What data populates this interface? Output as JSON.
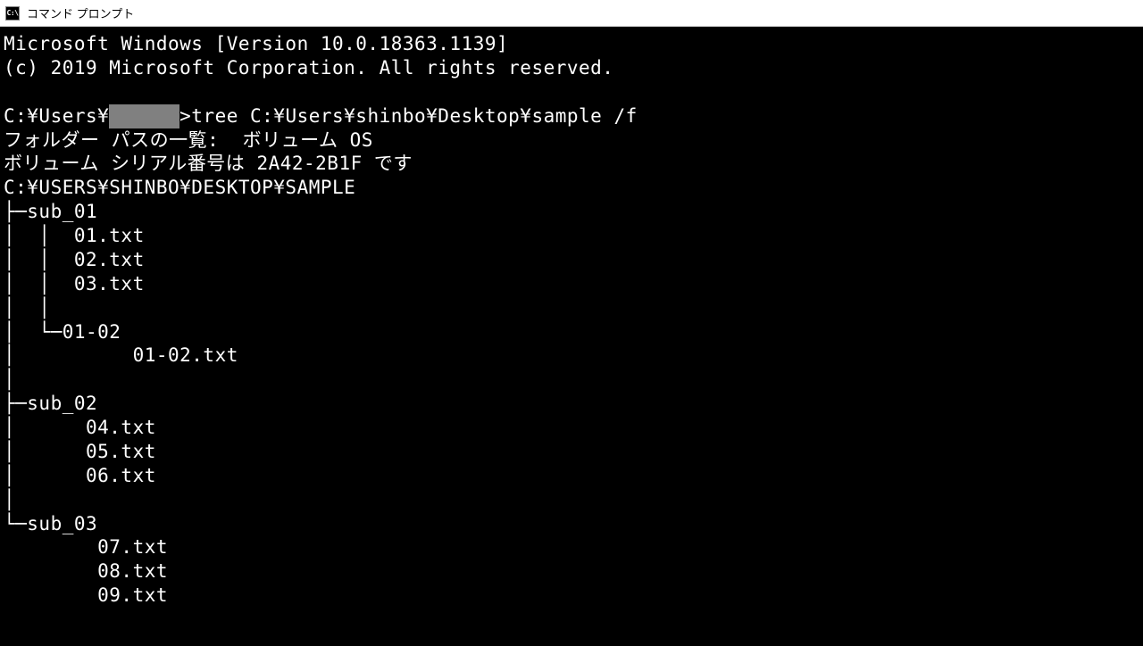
{
  "titlebar": {
    "icon_label": "C:\\",
    "title": "コマンド プロンプト"
  },
  "terminal": {
    "header_line1": "Microsoft Windows [Version 10.0.18363.1139]",
    "header_line2": "(c) 2019 Microsoft Corporation. All rights reserved.",
    "prompt_prefix": "C:¥Users¥",
    "prompt_redacted": "      ",
    "prompt_command": ">tree C:¥Users¥shinbo¥Desktop¥sample /f",
    "vol_line1": "フォルダー パスの一覧:  ボリューム OS",
    "vol_line2": "ボリューム シリアル番号は 2A42-2B1F です",
    "root_path": "C:¥USERS¥SHINBO¥DESKTOP¥SAMPLE",
    "tree": {
      "l01": "├─sub_01",
      "l02": "│  │  01.txt",
      "l03": "│  │  02.txt",
      "l04": "│  │  03.txt",
      "l05": "│  │",
      "l06": "│  └─01-02",
      "l07": "│          01-02.txt",
      "l08": "│",
      "l09": "├─sub_02",
      "l10": "│      04.txt",
      "l11": "│      05.txt",
      "l12": "│      06.txt",
      "l13": "│",
      "l14": "└─sub_03",
      "l15": "        07.txt",
      "l16": "        08.txt",
      "l17": "        09.txt"
    }
  }
}
